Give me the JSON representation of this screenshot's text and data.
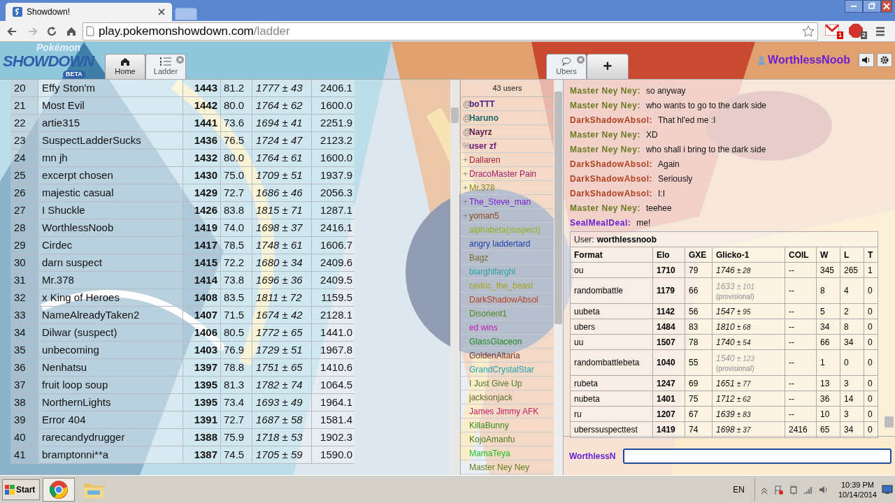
{
  "browser": {
    "tab_title": "Showdown!",
    "url_host": "play.pokemonshowdown.com",
    "url_path": "/ladder",
    "gmail_count": "1",
    "adblock_count": "2"
  },
  "header": {
    "logo_top": "Pokémon",
    "logo_main": "SHOWDOWN",
    "logo_badge": "BETA",
    "username": "WorthlessNoob",
    "tabs": [
      {
        "label": "Home",
        "kind": "home",
        "selected": false,
        "closable": false
      },
      {
        "label": "Ladder",
        "kind": "ladder",
        "selected": true,
        "closable": true
      },
      {
        "label": "Ubers",
        "kind": "chat",
        "selected": true,
        "closable": true
      },
      {
        "label": "+",
        "kind": "add",
        "selected": false,
        "closable": false
      }
    ]
  },
  "ladder": {
    "rows": [
      [
        "20",
        "Effy Ston'm",
        "1443",
        "81.2",
        "1777 ± 43",
        "2406.1"
      ],
      [
        "21",
        "Most Evil",
        "1442",
        "80.0",
        "1764 ± 62",
        "1600.0"
      ],
      [
        "22",
        "artie315",
        "1441",
        "73.6",
        "1694 ± 41",
        "2251.9"
      ],
      [
        "23",
        "SuspectLadderSucks",
        "1436",
        "76.5",
        "1724 ± 47",
        "2123.2"
      ],
      [
        "24",
        "mn jh",
        "1432",
        "80.0",
        "1764 ± 61",
        "1600.0"
      ],
      [
        "25",
        "excerpt chosen",
        "1430",
        "75.0",
        "1709 ± 51",
        "1937.9"
      ],
      [
        "26",
        "majestic casual",
        "1429",
        "72.7",
        "1686 ± 46",
        "2056.3"
      ],
      [
        "27",
        "I Shuckle",
        "1426",
        "83.8",
        "1815 ± 71",
        "1287.1"
      ],
      [
        "28",
        "WorthlessNoob",
        "1419",
        "74.0",
        "1698 ± 37",
        "2416.1"
      ],
      [
        "29",
        "Cirdec",
        "1417",
        "78.5",
        "1748 ± 61",
        "1606.7"
      ],
      [
        "30",
        "darn suspect",
        "1415",
        "72.2",
        "1680 ± 34",
        "2409.6"
      ],
      [
        "31",
        "Mr.378",
        "1414",
        "73.8",
        "1696 ± 36",
        "2409.5"
      ],
      [
        "32",
        "x King of Heroes",
        "1408",
        "83.5",
        "1811 ± 72",
        "1159.5"
      ],
      [
        "33",
        "NameAlreadyTaken2",
        "1407",
        "71.5",
        "1674 ± 42",
        "2128.1"
      ],
      [
        "34",
        "Dilwar (suspect)",
        "1406",
        "80.5",
        "1772 ± 65",
        "1441.0"
      ],
      [
        "35",
        "unbecoming",
        "1403",
        "76.9",
        "1729 ± 51",
        "1967.8"
      ],
      [
        "36",
        "Nenhatsu",
        "1397",
        "78.8",
        "1751 ± 65",
        "1410.6"
      ],
      [
        "37",
        "fruit loop soup",
        "1395",
        "81.3",
        "1782 ± 74",
        "1064.5"
      ],
      [
        "38",
        "NorthernLights",
        "1395",
        "73.4",
        "1693 ± 49",
        "1964.1"
      ],
      [
        "39",
        "Error 404",
        "1391",
        "72.7",
        "1687 ± 58",
        "1581.4"
      ],
      [
        "40",
        "rarecandydrugger",
        "1388",
        "75.9",
        "1718 ± 53",
        "1902.3"
      ],
      [
        "41",
        "bramptonni**a",
        "1387",
        "74.5",
        "1705 ± 59",
        "1590.0"
      ]
    ]
  },
  "userlist": {
    "count": "43 users",
    "users": [
      {
        "group": "@",
        "name": "boTTT",
        "kind": "staff",
        "color": "#4a1d86"
      },
      {
        "group": "@",
        "name": "Haruno",
        "kind": "staff",
        "color": "#1d6868"
      },
      {
        "group": "@",
        "name": "Nayrz",
        "kind": "staff",
        "color": "#5c1c48"
      },
      {
        "group": "%",
        "name": "user zf",
        "kind": "staff",
        "color": "#6a1c78"
      },
      {
        "group": "+",
        "name": "Dallaren",
        "kind": "voice",
        "color": "#a41e3c"
      },
      {
        "group": "+",
        "name": "DracoMaster Pain",
        "kind": "voice",
        "color": "#a21e66"
      },
      {
        "group": "+",
        "name": "Mr.378",
        "kind": "voice",
        "color": "#8a8a1e"
      },
      {
        "group": "+",
        "name": "The_Steve_man",
        "kind": "voice",
        "color": "#7a1ed2"
      },
      {
        "group": "+",
        "name": "yoman5",
        "kind": "voice",
        "color": "#8a4a1e"
      },
      {
        "name": "alphabeta(suspect)",
        "kind": "regular",
        "color": "#8cb41e"
      },
      {
        "name": "angry laddertard",
        "kind": "regular",
        "color": "#1e3ea4"
      },
      {
        "name": "Bagz",
        "kind": "regular",
        "color": "#7a6a2a"
      },
      {
        "name": "blarghlfarghl",
        "kind": "regular",
        "color": "#2aa2a2"
      },
      {
        "name": "cedric_the_beast",
        "kind": "regular",
        "color": "#a4a41e"
      },
      {
        "name": "DarkShadowAbsol",
        "kind": "regular",
        "color": "#b2401e"
      },
      {
        "name": "Disorient1",
        "kind": "regular",
        "color": "#4a8a1e"
      },
      {
        "name": "ed wins",
        "kind": "regular",
        "color": "#c21eb2"
      },
      {
        "name": "GlassGlaceon",
        "kind": "regular",
        "color": "#1e8a1e"
      },
      {
        "name": "GoldenAltaria",
        "kind": "regular",
        "color": "#7a301e"
      },
      {
        "name": "GrandCrystalStar",
        "kind": "regular",
        "color": "#1ea2b2"
      },
      {
        "name": "I Just Give Up",
        "kind": "regular",
        "color": "#4a7a1e"
      },
      {
        "name": "jacksonjack",
        "kind": "regular",
        "color": "#5a6a30"
      },
      {
        "name": "James Jimmy AFK",
        "kind": "regular",
        "color": "#c21e62"
      },
      {
        "name": "KillaBunny",
        "kind": "regular",
        "color": "#3a8a1e"
      },
      {
        "name": "KojoAmanfu",
        "kind": "regular",
        "color": "#4a7a1e"
      },
      {
        "name": "MamaTeya",
        "kind": "regular",
        "color": "#1ec21e"
      },
      {
        "name": "Master Ney Ney",
        "kind": "regular",
        "color": "#6a7a1e"
      }
    ]
  },
  "chat": {
    "messages": [
      {
        "name": "Master Ney Ney:",
        "color": "#6a7a1e",
        "text": "so anyway"
      },
      {
        "name": "Master Ney Ney:",
        "color": "#6a7a1e",
        "text": "who wants to go to the dark side"
      },
      {
        "name": "DarkShadowAbsol:",
        "color": "#b2401e",
        "text": "That hl'ed me :I"
      },
      {
        "name": "Master Ney Ney:",
        "color": "#6a7a1e",
        "text": "XD"
      },
      {
        "name": "Master Ney Ney:",
        "color": "#6a7a1e",
        "text": "who shall i bring to the dark side"
      },
      {
        "name": "DarkShadowAbsol:",
        "color": "#b2401e",
        "text": "Again"
      },
      {
        "name": "DarkShadowAbsol:",
        "color": "#b2401e",
        "text": "Seriously"
      },
      {
        "name": "DarkShadowAbsol:",
        "color": "#b2401e",
        "text": "I:I"
      },
      {
        "name": "Master Ney Ney:",
        "color": "#6a7a1e",
        "text": "teehee"
      },
      {
        "name": "SealMealDeal:",
        "color": "#6a1ed2",
        "text": "me!"
      }
    ],
    "stats": {
      "user_label": "User:",
      "username": "worthlessnoob",
      "columns": [
        "Format",
        "Elo",
        "GXE",
        "Glicko-1",
        "COIL",
        "W",
        "L",
        "T"
      ],
      "rows": [
        {
          "format": "ou",
          "elo": "1710",
          "gxe": "79",
          "glicko": "1746",
          "dev": "± 28",
          "provisional": false,
          "coil": "--",
          "w": "345",
          "l": "265",
          "t": "1"
        },
        {
          "format": "randombattle",
          "elo": "1179",
          "gxe": "66",
          "glicko": "1633",
          "dev": "± 101",
          "provisional": true,
          "note": "(provisional)",
          "coil": "--",
          "w": "8",
          "l": "4",
          "t": "0"
        },
        {
          "format": "uubeta",
          "elo": "1142",
          "gxe": "56",
          "glicko": "1547",
          "dev": "± 95",
          "provisional": false,
          "coil": "--",
          "w": "5",
          "l": "2",
          "t": "0"
        },
        {
          "format": "ubers",
          "elo": "1484",
          "gxe": "83",
          "glicko": "1810",
          "dev": "± 68",
          "provisional": false,
          "coil": "--",
          "w": "34",
          "l": "8",
          "t": "0"
        },
        {
          "format": "uu",
          "elo": "1507",
          "gxe": "78",
          "glicko": "1740",
          "dev": "± 54",
          "provisional": false,
          "coil": "--",
          "w": "66",
          "l": "34",
          "t": "0"
        },
        {
          "format": "randombattlebeta",
          "elo": "1040",
          "gxe": "55",
          "glicko": "1540",
          "dev": "± 123",
          "provisional": true,
          "note": "(provisional)",
          "coil": "--",
          "w": "1",
          "l": "0",
          "t": "0"
        },
        {
          "format": "rubeta",
          "elo": "1247",
          "gxe": "69",
          "glicko": "1651",
          "dev": "± 77",
          "provisional": false,
          "coil": "--",
          "w": "13",
          "l": "3",
          "t": "0"
        },
        {
          "format": "nubeta",
          "elo": "1401",
          "gxe": "75",
          "glicko": "1712",
          "dev": "± 62",
          "provisional": false,
          "coil": "--",
          "w": "36",
          "l": "14",
          "t": "0"
        },
        {
          "format": "ru",
          "elo": "1207",
          "gxe": "67",
          "glicko": "1639",
          "dev": "± 83",
          "provisional": false,
          "coil": "--",
          "w": "10",
          "l": "3",
          "t": "0"
        },
        {
          "format": "uberssuspecttest",
          "elo": "1419",
          "gxe": "74",
          "glicko": "1698",
          "dev": "± 37",
          "provisional": false,
          "coil": "2416",
          "w": "65",
          "l": "34",
          "t": "0"
        }
      ]
    },
    "input_label": "WorthlessN"
  },
  "taskbar": {
    "start": "Start",
    "language": "EN",
    "time": "10:39 PM",
    "date": "10/14/2014"
  }
}
